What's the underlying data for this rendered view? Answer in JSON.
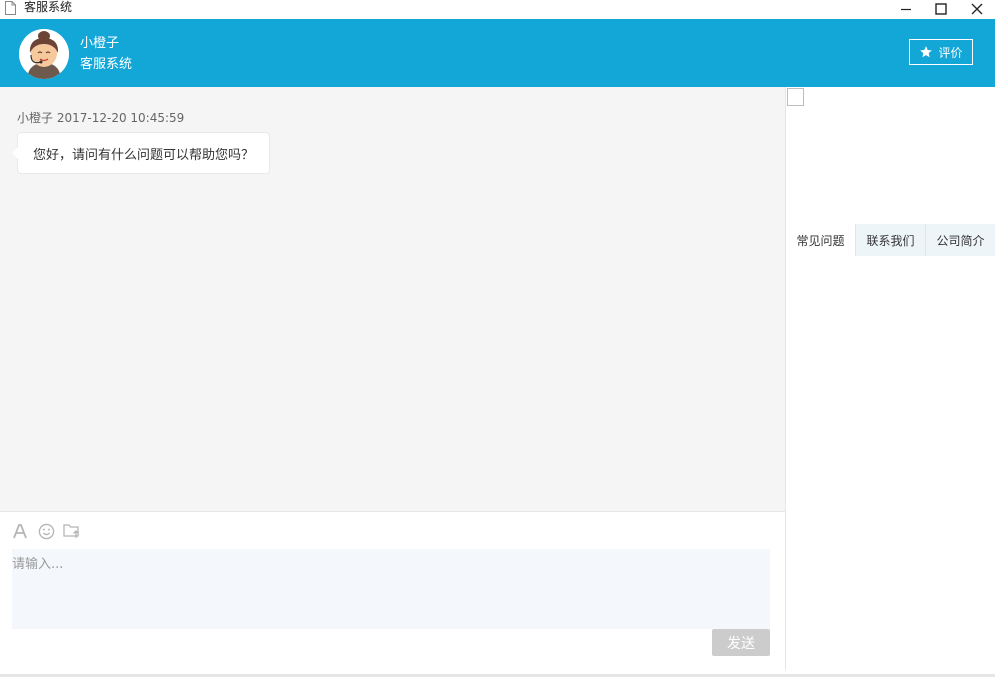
{
  "window": {
    "title": "客服系统"
  },
  "header": {
    "agent_name": "小橙子",
    "agent_subtitle": "客服系统",
    "rate_label": "评价",
    "color": "#13a7d8"
  },
  "messages": [
    {
      "sender": "小橙子",
      "time": "2017-12-20 10:45:59",
      "text": "您好，请问有什么问题可以帮助您吗？"
    }
  ],
  "toolbar": {
    "icons": [
      "font-icon",
      "emoji-icon",
      "file-upload-icon"
    ]
  },
  "input": {
    "placeholder": "请输入...",
    "value": ""
  },
  "send_label": "发送",
  "side_tabs": [
    {
      "label": "常见问题",
      "active": true
    },
    {
      "label": "联系我们",
      "active": false
    },
    {
      "label": "公司简介",
      "active": false
    }
  ]
}
